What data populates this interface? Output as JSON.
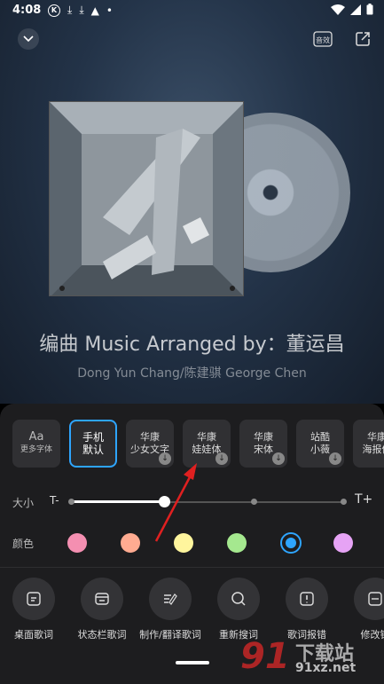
{
  "status_bar": {
    "time": "4:08",
    "k_badge": "K",
    "battery_icon": "battery-icon",
    "wifi_icon": "wifi-icon"
  },
  "header": {
    "collapse_icon": "chevron-down-icon",
    "dolby_label": "音效",
    "share_icon": "share-icon"
  },
  "song": {
    "title": "编曲 Music Arranged by：董运昌",
    "subtitle": "Dong Yun Chang/陈建骐 George Chen"
  },
  "fonts": {
    "more": {
      "aa": "Aa",
      "label": "更多字体"
    },
    "items": [
      {
        "line1": "手机",
        "line2": "默认",
        "selected": true,
        "download": false
      },
      {
        "line1": "华康",
        "line2": "少女文字",
        "download": true
      },
      {
        "line1": "华康",
        "line2": "娃娃体",
        "download": true
      },
      {
        "line1": "华康",
        "line2": "宋体",
        "download": true
      },
      {
        "line1": "站酷",
        "line2": "小薇",
        "download": true
      },
      {
        "line1": "华康",
        "line2": "海报体",
        "download": false
      }
    ]
  },
  "size": {
    "label": "大小",
    "min_label": "T-",
    "max_label": "T+",
    "level_fraction": 0.34
  },
  "colors": {
    "label": "颜色",
    "swatches": [
      "#f48fb1",
      "#ffab91",
      "#fff59d",
      "#a5e88f",
      "#2ea5ff",
      "#e6a3f5"
    ],
    "selected_index": 4
  },
  "actions": [
    {
      "label": "桌面歌词",
      "icon": "desktop-lyrics-icon"
    },
    {
      "label": "状态栏歌词",
      "icon": "statusbar-lyrics-icon"
    },
    {
      "label": "制作/翻译歌词",
      "icon": "edit-lyrics-icon"
    },
    {
      "label": "重新搜词",
      "icon": "search-icon"
    },
    {
      "label": "歌词报错",
      "icon": "report-icon"
    },
    {
      "label": "修改错",
      "icon": "modify-icon"
    }
  ],
  "watermark": {
    "number": "91",
    "text": "下载站",
    "url": "91xz.net"
  }
}
